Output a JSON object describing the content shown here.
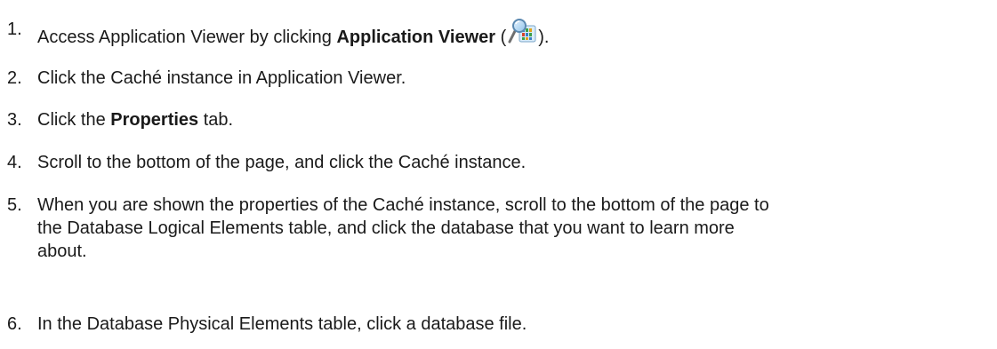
{
  "steps": [
    {
      "number": "1.",
      "text_before": "Access Application Viewer by clicking ",
      "bold": "Application Viewer",
      "text_after_bold": " (",
      "icon": "application-viewer-icon",
      "text_after_icon": ")."
    },
    {
      "number": "2.",
      "text": "Click the Caché instance in Application Viewer."
    },
    {
      "number": "3.",
      "text_before": "Click the ",
      "bold": "Properties",
      "text_after": " tab."
    },
    {
      "number": "4.",
      "text": "Scroll to the bottom of the page, and click the Caché instance."
    },
    {
      "number": "5.",
      "line1": "When you are shown the properties of the Caché instance, scroll to the bottom of the page to",
      "line2": "the Database Logical Elements table, and click the database that you want to learn more",
      "line3": "about."
    },
    {
      "number": "6.",
      "text": "In the Database Physical Elements table, click a database file."
    }
  ]
}
